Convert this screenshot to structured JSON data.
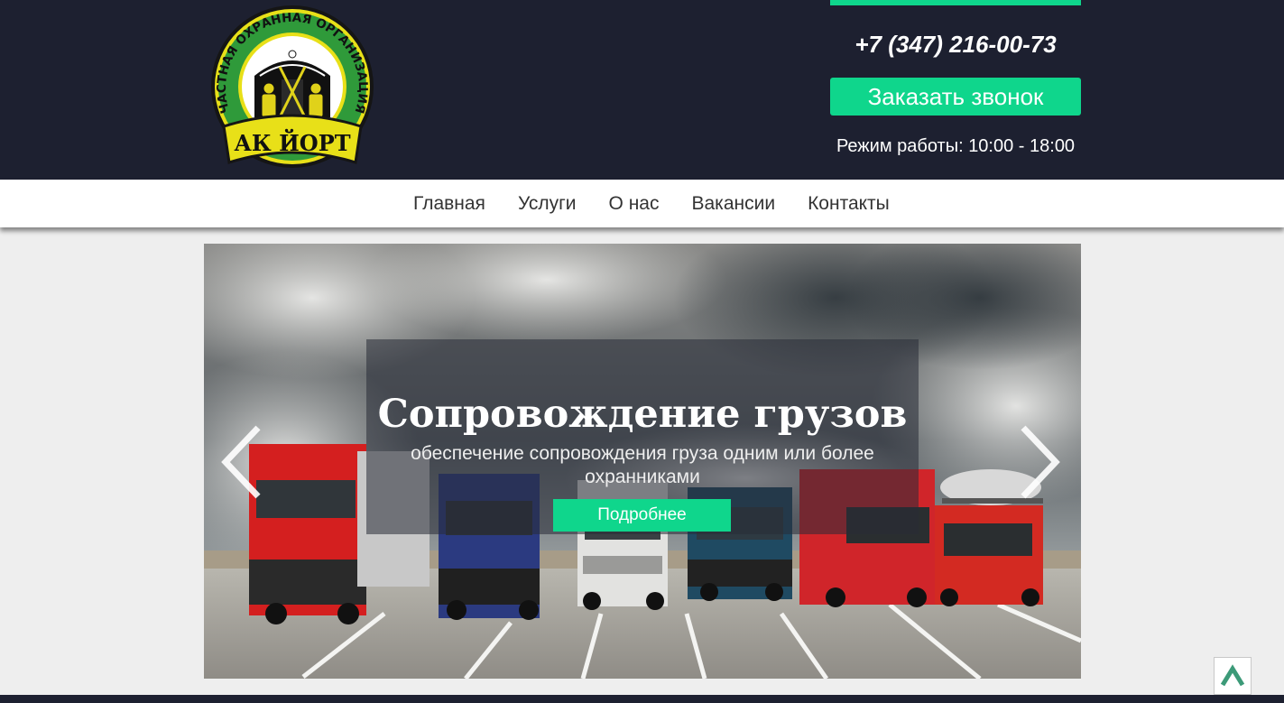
{
  "header": {
    "logo": {
      "ring_text": "ЧАСТНАЯ ОХРАННАЯ ОРГАНИЗАЦИЯ",
      "name": "АК ЙОРТ"
    },
    "phone": "+7 (347) 216-00-73",
    "call_button_label": "Заказать звонок",
    "hours": "Режим работы: 10:00 - 18:00"
  },
  "nav": {
    "items": [
      {
        "label": "Главная"
      },
      {
        "label": "Услуги"
      },
      {
        "label": "О нас"
      },
      {
        "label": "Вакансии"
      },
      {
        "label": "Контакты"
      }
    ]
  },
  "slider": {
    "title": "Сопровождение грузов",
    "subtitle": "обеспечение сопровождения груза одним или более охранниками",
    "more_button_label": "Подробнее",
    "prev_icon": "chevron-left-icon",
    "next_icon": "chevron-right-icon"
  },
  "scroll_top": {
    "icon": "chevron-up-icon"
  },
  "colors": {
    "header_bg": "#1d2030",
    "accent": "#0fd68c",
    "page_bg": "#eeeeee"
  }
}
